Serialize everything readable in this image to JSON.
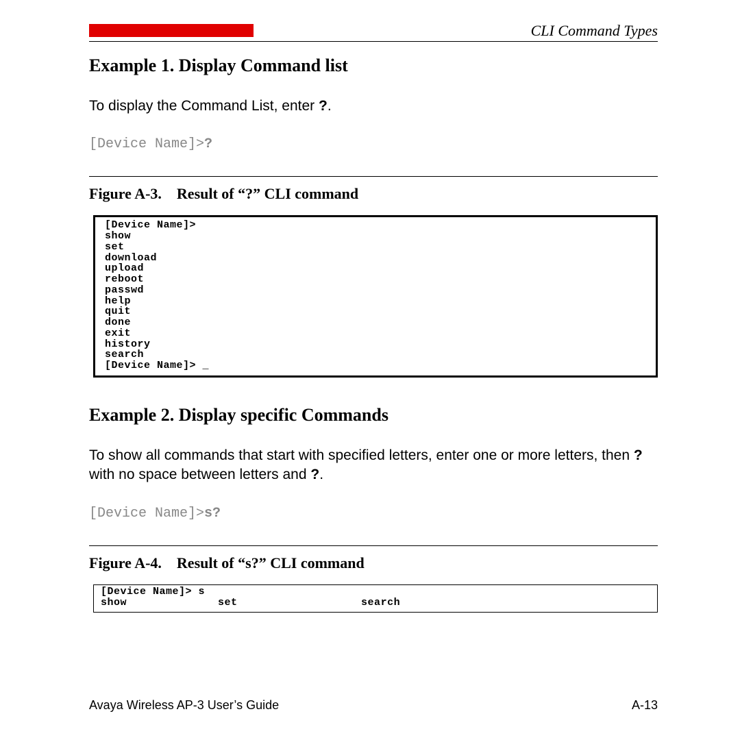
{
  "header": {
    "section_title": "CLI Command Types"
  },
  "example1": {
    "heading": "Example 1. Display Command list",
    "body_pre": "To display the Command List, enter ",
    "body_q": "?",
    "body_post": ".",
    "prompt_prefix": "[Device Name]>",
    "prompt_cmd": "?"
  },
  "figureA3": {
    "num": "Figure A-3.",
    "title": "Result of “?” CLI command",
    "terminal": "[Device Name]>\nshow\nset\ndownload\nupload\nreboot\npasswd\nhelp\nquit\ndone\nexit\nhistory\nsearch\n[Device Name]> _"
  },
  "example2": {
    "heading": "Example 2. Display specific Commands",
    "body_line1_pre": "To show all commands that start with specified letters, enter one or more letters, then ",
    "body_q1": "?",
    "body_mid": " with no space between letters and ",
    "body_q2": "?",
    "body_post": ".",
    "prompt_prefix": "[Device Name]>",
    "prompt_cmd": "s?"
  },
  "figureA4": {
    "num": "Figure A-4.",
    "title": "Result of “s?” CLI command",
    "terminal": "[Device Name]> s\nshow              set                   search"
  },
  "footer": {
    "left": "Avaya Wireless AP-3 User’s Guide",
    "right": "A-13"
  }
}
